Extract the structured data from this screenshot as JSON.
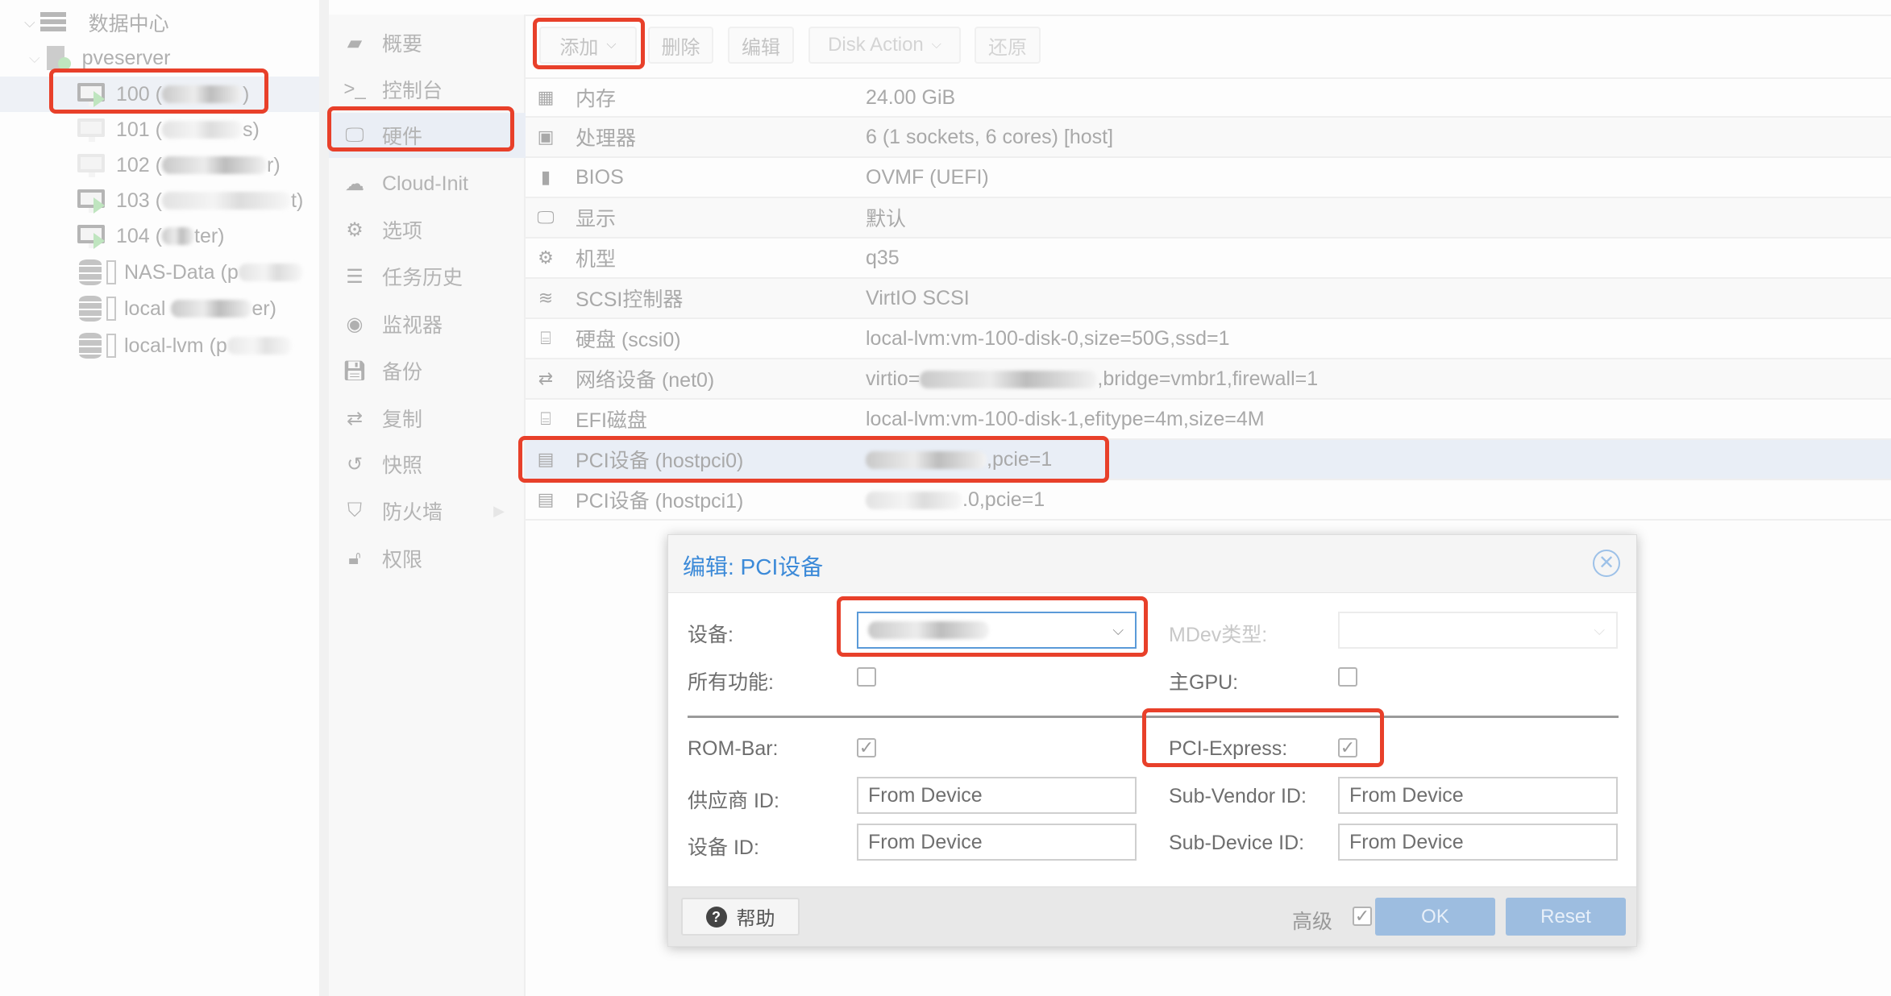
{
  "tree": {
    "datacenter": "数据中心",
    "node": "pveserver",
    "vms": [
      {
        "id": "100",
        "name_tail": ")",
        "running": true
      },
      {
        "id": "101",
        "name_tail": "s)",
        "running": false
      },
      {
        "id": "102",
        "name_tail": "r)",
        "running": false
      },
      {
        "id": "103",
        "name_tail": "t)",
        "running": true
      },
      {
        "id": "104",
        "name_tail": "ter)",
        "running": true
      }
    ],
    "storages": [
      {
        "name": "NAS-Data",
        "name_tail": "(p"
      },
      {
        "name": "local",
        "name_tail": "er)"
      },
      {
        "name": "local-lvm",
        "name_tail": "(p"
      }
    ]
  },
  "nav": {
    "items": [
      {
        "label": "概要",
        "icon": "book-icon"
      },
      {
        "label": "控制台",
        "icon": "terminal-icon"
      },
      {
        "label": "硬件",
        "icon": "monitor-icon"
      },
      {
        "label": "Cloud-Init",
        "icon": "cloud-icon"
      },
      {
        "label": "选项",
        "icon": "gear-icon"
      },
      {
        "label": "任务历史",
        "icon": "list-icon"
      },
      {
        "label": "监视器",
        "icon": "eye-icon"
      },
      {
        "label": "备份",
        "icon": "floppy-icon"
      },
      {
        "label": "复制",
        "icon": "retweet-icon"
      },
      {
        "label": "快照",
        "icon": "history-icon"
      },
      {
        "label": "防火墙",
        "icon": "shield-icon"
      },
      {
        "label": "权限",
        "icon": "unlock-icon"
      }
    ]
  },
  "toolbar": {
    "add": "添加",
    "remove": "删除",
    "edit": "编辑",
    "disk_action": "Disk Action",
    "revert": "还原"
  },
  "hardware": [
    {
      "name": "内存",
      "value": "24.00 GiB",
      "icon": "memory-icon"
    },
    {
      "name": "处理器",
      "value": "6 (1 sockets, 6 cores) [host]",
      "icon": "cpu-icon"
    },
    {
      "name": "BIOS",
      "value": "OVMF (UEFI)",
      "icon": "chip-icon"
    },
    {
      "name": "显示",
      "value": "默认",
      "icon": "display-icon"
    },
    {
      "name": "机型",
      "value": "q35",
      "icon": "gears-icon"
    },
    {
      "name": "SCSI控制器",
      "value": "VirtIO SCSI",
      "icon": "database-icon"
    },
    {
      "name": "硬盘 (scsi0)",
      "value": "local-lvm:vm-100-disk-0,size=50G,ssd=1",
      "icon": "hdd-icon"
    },
    {
      "name": "网络设备 (net0)",
      "value": "virtio=",
      "value_tail": ",bridge=vmbr1,firewall=1",
      "icon": "exchange-icon"
    },
    {
      "name": "EFI磁盘",
      "value": "local-lvm:vm-100-disk-1,efitype=4m,size=4M",
      "icon": "hdd-icon"
    },
    {
      "name": "PCI设备 (hostpci0)",
      "value": "",
      "value_tail": ",pcie=1",
      "icon": "pci-card-icon"
    },
    {
      "name": "PCI设备 (hostpci1)",
      "value": "",
      "value_tail": ".0,pcie=1",
      "icon": "pci-card-icon"
    }
  ],
  "dialog": {
    "title": "编辑: PCI设备",
    "device_label": "设备:",
    "mdev_label": "MDev类型:",
    "all_functions_label": "所有功能:",
    "all_functions": false,
    "primary_gpu_label": "主GPU:",
    "primary_gpu": false,
    "rombar_label": "ROM-Bar:",
    "rombar": true,
    "pcie_label": "PCI-Express:",
    "pcie": true,
    "vendor_id_label": "供应商 ID:",
    "vendor_id_placeholder": "From Device",
    "device_id_label": "设备 ID:",
    "device_id_placeholder": "From Device",
    "sub_vendor_label": "Sub-Vendor ID:",
    "sub_vendor_placeholder": "From Device",
    "sub_device_label": "Sub-Device ID:",
    "sub_device_placeholder": "From Device",
    "help": "帮助",
    "advanced": "高级",
    "advanced_checked": true,
    "ok": "OK",
    "reset": "Reset"
  },
  "colors": {
    "highlight": "#e8402a",
    "accent": "#3c8ad8",
    "button": "#9dbde0"
  }
}
